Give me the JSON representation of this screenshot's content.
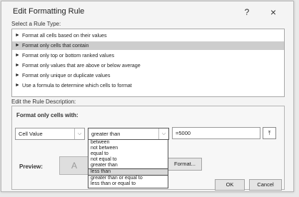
{
  "dialog": {
    "title": "Edit Formatting Rule",
    "help_label": "?",
    "close_label": "×"
  },
  "rule_type": {
    "label": "Select a Rule Type:",
    "items": [
      {
        "label": "Format all cells based on their values",
        "selected": false
      },
      {
        "label": "Format only cells that contain",
        "selected": true
      },
      {
        "label": "Format only top or bottom ranked values",
        "selected": false
      },
      {
        "label": "Format only values that are above or below average",
        "selected": false
      },
      {
        "label": "Format only unique or duplicate values",
        "selected": false
      },
      {
        "label": "Use a formula to determine which cells to format",
        "selected": false
      }
    ],
    "arrow": "►"
  },
  "description": {
    "label": "Edit the Rule Description:",
    "format_only_label": "Format only cells with:",
    "cell_value_combo": "Cell Value",
    "operator_combo": "greater than",
    "value_field": "=5000",
    "ref_button": "⤒",
    "preview_label": "Preview:",
    "preview_text": "A",
    "format_button": "Format..."
  },
  "operator_dropdown": {
    "items": [
      "between",
      "not between",
      "equal to",
      "not equal to",
      "greater than",
      "less than",
      "greater than or equal to",
      "less than or equal to"
    ],
    "highlighted_index": 5
  },
  "buttons": {
    "ok": "OK",
    "cancel": "Cancel"
  },
  "colors": {
    "selection": "#cdcdcd",
    "dialog_bg": "#f4f4f4"
  }
}
